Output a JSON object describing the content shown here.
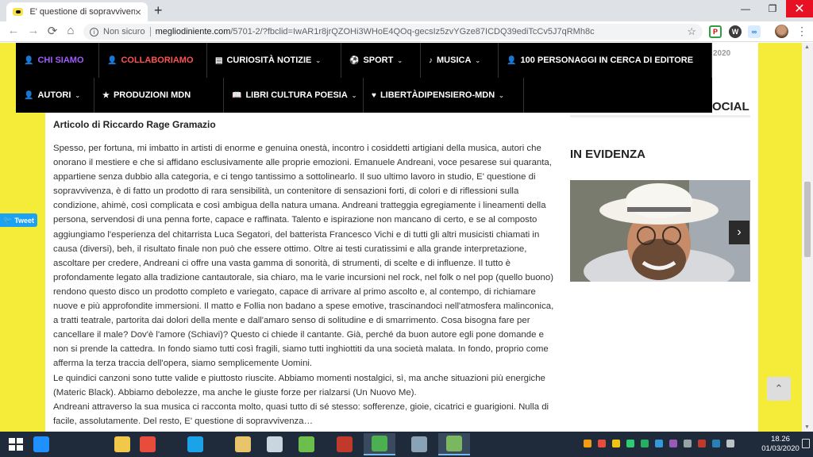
{
  "browser": {
    "tab_title": "E' questione di sopravvivenza - E",
    "tab_close": "×",
    "new_tab": "+",
    "window_minimize": "—",
    "window_maximize": "❐",
    "window_close": "✕",
    "nav_back": "←",
    "nav_forward": "→",
    "nav_reload": "⟳",
    "nav_home": "⌂",
    "security_label": "Non sicuro",
    "url_host": "megliodiniente.com",
    "url_path": "/5701-2/?fbclid=IwAR1r8jrQZOHi3WHoE4QOq-gecsIz5zvYGze87ICDQ39ediTcCv5J7qRMh8c",
    "bookmark_star": "☆",
    "menu_dots": "⋮",
    "extensions": [
      "pdf-extension-icon",
      "wordpress-icon",
      "link-extension-icon"
    ]
  },
  "site": {
    "colors": {
      "accent_yellow": "#f5ec3a",
      "nav_bg": "#000000",
      "chi_siamo": "#a05cff",
      "collaboriamo": "#ff5252"
    },
    "nav": [
      {
        "label": "CHI SIAMO",
        "icon": "user-icon",
        "glyph": "👤",
        "dropdown": false
      },
      {
        "label": "COLLABORIAMO",
        "icon": "user-icon",
        "glyph": "👤",
        "dropdown": false
      },
      {
        "label": "CURIOSITÀ NOTIZIE",
        "icon": "newspaper-icon",
        "glyph": "▤",
        "dropdown": true
      },
      {
        "label": "SPORT",
        "icon": "soccer-ball-icon",
        "glyph": "⚽",
        "dropdown": true
      },
      {
        "label": "MUSICA",
        "icon": "music-note-icon",
        "glyph": "♪",
        "dropdown": true
      },
      {
        "label": "100 PERSONAGGI IN CERCA DI EDITORE",
        "icon": "user-icon",
        "glyph": "👤",
        "dropdown": false
      },
      {
        "label": "AUTORI",
        "icon": "user-icon",
        "glyph": "👤",
        "dropdown": true
      },
      {
        "label": "PRODUZIONI MDN",
        "icon": "star-icon",
        "glyph": "★",
        "dropdown": false
      },
      {
        "label": "LIBRI CULTURA POESIA",
        "icon": "book-icon",
        "glyph": "📖",
        "dropdown": true
      },
      {
        "label": "LIBERTÀDIPENSIERO-MDN",
        "icon": "heart-icon",
        "glyph": "♥",
        "dropdown": true
      }
    ],
    "caret": "⌄",
    "date_fragment": "2020",
    "social_fragment": "OCIAL",
    "byline": "Articolo di Riccardo Rage Gramazio",
    "paragraphs": [
      "Spesso, per fortuna, mi imbatto in artisti di enorme e genuina onestà, incontro i cosiddetti artigiani della musica, autori che onorano il mestiere e che si affidano esclusivamente alle proprie emozioni. Emanuele Andreani, voce pesarese sui quaranta, appartiene senza dubbio alla categoria, e ci tengo tantissimo a sottolinearlo. Il suo ultimo lavoro in studio, E' questione di sopravvivenza, è di fatto un prodotto di rara sensibilità, un contenitore di sensazioni forti, di colori e di riflessioni sulla condizione, ahimè, così complicata e così ambigua della natura umana. Andreani tratteggia egregiamente i lineamenti della persona, servendosi di una penna forte, capace e raffinata. Talento e ispirazione non mancano di certo, e se al composto aggiungiamo l'esperienza del chitarrista Luca Segatori, del batterista Francesco Vichi e di tutti gli altri musicisti chiamati in causa (diversi), beh, il risultato finale non può che essere ottimo. Oltre ai testi curatissimi e alla grande interpretazione, ascoltare per credere, Andreani ci offre una vasta gamma di sonorità, di strumenti, di scelte e di influenze. Il tutto è profondamente legato alla tradizione cantautorale, sia chiaro, ma le varie incursioni nel rock, nel folk o nel pop (quello buono) rendono questo disco un prodotto completo e variegato, capace di arrivare al primo ascolto e, al contempo, di richiamare nuove e più approfondite immersioni. Il matto e Follia non badano a spese emotive, trascinandoci nell'atmosfera malinconica, a tratti teatrale, partorita dai dolori della mente e dall'amaro senso di solitudine e di smarrimento. Cosa bisogna fare per cancellare il male? Dov'è l'amore (Schiavi)? Questo ci chiede il cantante. Già, perché da buon autore egli pone domande e non si prende la cattedra. In fondo siamo tutti così fragili, siamo tutti inghiottiti da una società malata. In fondo, proprio come afferma la terza traccia dell'opera, siamo semplicemente Uomini.",
      "Le quindici canzoni sono tutte valide e piuttosto riuscite. Abbiamo momenti nostalgici, sì, ma anche situazioni più energiche (Materic Black). Abbiamo debolezze, ma anche le giuste forze per rialzarsi (Un Nuovo Me).",
      "Andreani attraverso la sua musica ci racconta molto, quasi tutto di sé stesso: sofferenze, gioie, cicatrici e guarigioni. Nulla di facile, assolutamente. Del resto, E' questione di sopravvivenza…"
    ],
    "sidebar_heading": "IN EVIDENZA",
    "carousel_next": "›",
    "tweet_label": "Tweet",
    "back_to_top": "⌃"
  },
  "taskbar": {
    "apps": [
      {
        "name": "internet-explorer-icon",
        "color": "#1e90ff",
        "active": false
      },
      {
        "name": "windows-explorer-icon",
        "color": "#f2c84b",
        "active": false
      },
      {
        "name": "media-player-icon",
        "color": "#e84c3d",
        "active": false
      },
      {
        "name": "sky-go-icon",
        "color": "#1aa3e8",
        "active": false
      },
      {
        "name": "file-manager-icon",
        "color": "#e9c46a",
        "active": false
      },
      {
        "name": "file-cabinet-icon",
        "color": "#c9d6df",
        "active": false
      },
      {
        "name": "chart-app-icon",
        "color": "#6dbf4b",
        "active": false
      },
      {
        "name": "power-app-icon",
        "color": "#c0392b",
        "active": false
      },
      {
        "name": "chrome-icon",
        "color": "#4caf50",
        "active": true
      },
      {
        "name": "network-app-icon",
        "color": "#8aa1b6",
        "active": false
      },
      {
        "name": "calculator-app-icon",
        "color": "#7bb661",
        "active": true
      }
    ],
    "tray_colors": [
      "#f39c12",
      "#e74c3c",
      "#f1c40f",
      "#2ecc71",
      "#27ae60",
      "#3498db",
      "#9b59b6",
      "#95a5a6",
      "#c0392b",
      "#2980b9",
      "#bdc3c7"
    ],
    "time": "18.26",
    "date": "01/03/2020"
  }
}
